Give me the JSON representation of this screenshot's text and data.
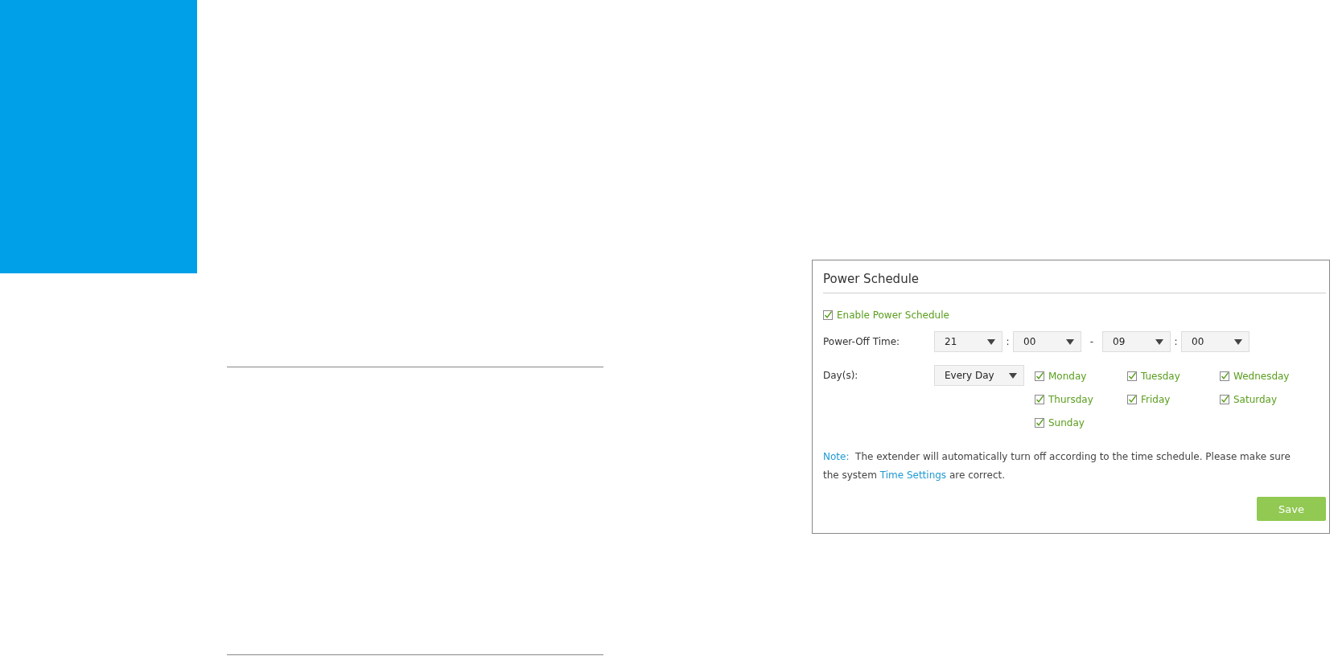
{
  "panel": {
    "title": "Power Schedule",
    "enable": {
      "label": "Enable Power Schedule",
      "checked": true
    },
    "power_off": {
      "label": "Power-Off Time:",
      "fields": [
        {
          "kind": "select",
          "value": "21"
        },
        {
          "kind": "sep",
          "value": ":"
        },
        {
          "kind": "select",
          "value": "00"
        },
        {
          "kind": "sep",
          "value": "-"
        },
        {
          "kind": "select",
          "value": "09"
        },
        {
          "kind": "sep",
          "value": ":"
        },
        {
          "kind": "select",
          "value": "00"
        }
      ]
    },
    "days": {
      "label": "Day(s):",
      "select": "Every Day",
      "items": [
        {
          "label": "Monday",
          "checked": true
        },
        {
          "label": "Tuesday",
          "checked": true
        },
        {
          "label": "Wednesday",
          "checked": true
        },
        {
          "label": "Thursday",
          "checked": true
        },
        {
          "label": "Friday",
          "checked": true
        },
        {
          "label": "Saturday",
          "checked": true
        },
        {
          "label": "Sunday",
          "checked": true
        }
      ]
    },
    "note": {
      "label": "Note:",
      "before": "The extender will automatically turn off according to the time schedule. Please make sure the system ",
      "link": "Time Settings",
      "after": " are correct."
    },
    "save": "Save"
  }
}
